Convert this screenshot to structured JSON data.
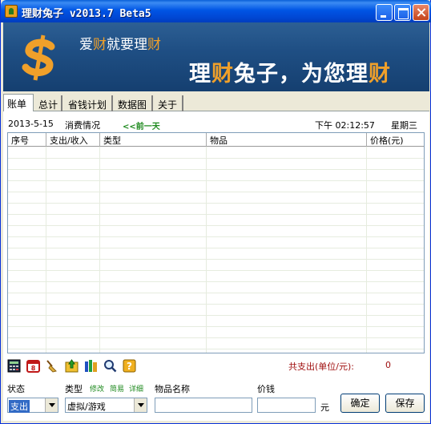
{
  "window": {
    "title": "理财兔子 v2013.7 Beta5"
  },
  "banner": {
    "slogan1": {
      "a": "爱",
      "b": "财",
      "c": "就要理",
      "d": "财"
    },
    "slogan2": {
      "a": "理",
      "b": "财",
      "c": "兔子，为您理",
      "d": "财"
    },
    "accent_color": "#f0a02a"
  },
  "tabs": [
    {
      "label": "账单",
      "active": true
    },
    {
      "label": "总计"
    },
    {
      "label": "省钱计划"
    },
    {
      "label": "数据图"
    },
    {
      "label": "关于"
    }
  ],
  "info": {
    "date": "2013-5-15",
    "section": "消费情况",
    "prev_day": "<<前一天",
    "time": "下午 02:12:57",
    "weekday": "星期三"
  },
  "table": {
    "columns": [
      "序号",
      "支出/收入",
      "类型",
      "物品",
      "价格(元)"
    ],
    "rows": []
  },
  "toolbar_icons": [
    "calculator-icon",
    "calendar-icon",
    "broom-icon",
    "export-icon",
    "books-icon",
    "magnifier-icon",
    "help-icon"
  ],
  "summary": {
    "label": "共支出(单位/元):",
    "value": "0"
  },
  "form": {
    "status_label": "状态",
    "type_label": "类型",
    "edit_link": "修改",
    "simple_link": "简易",
    "detail_link": "详细",
    "item_name_label": "物品名称",
    "price_label": "价钱",
    "status_value": "支出",
    "type_value": "虚拟/游戏",
    "item_name_value": "",
    "price_value": "",
    "currency": "元",
    "confirm_button": "确定",
    "save_button": "保存"
  }
}
